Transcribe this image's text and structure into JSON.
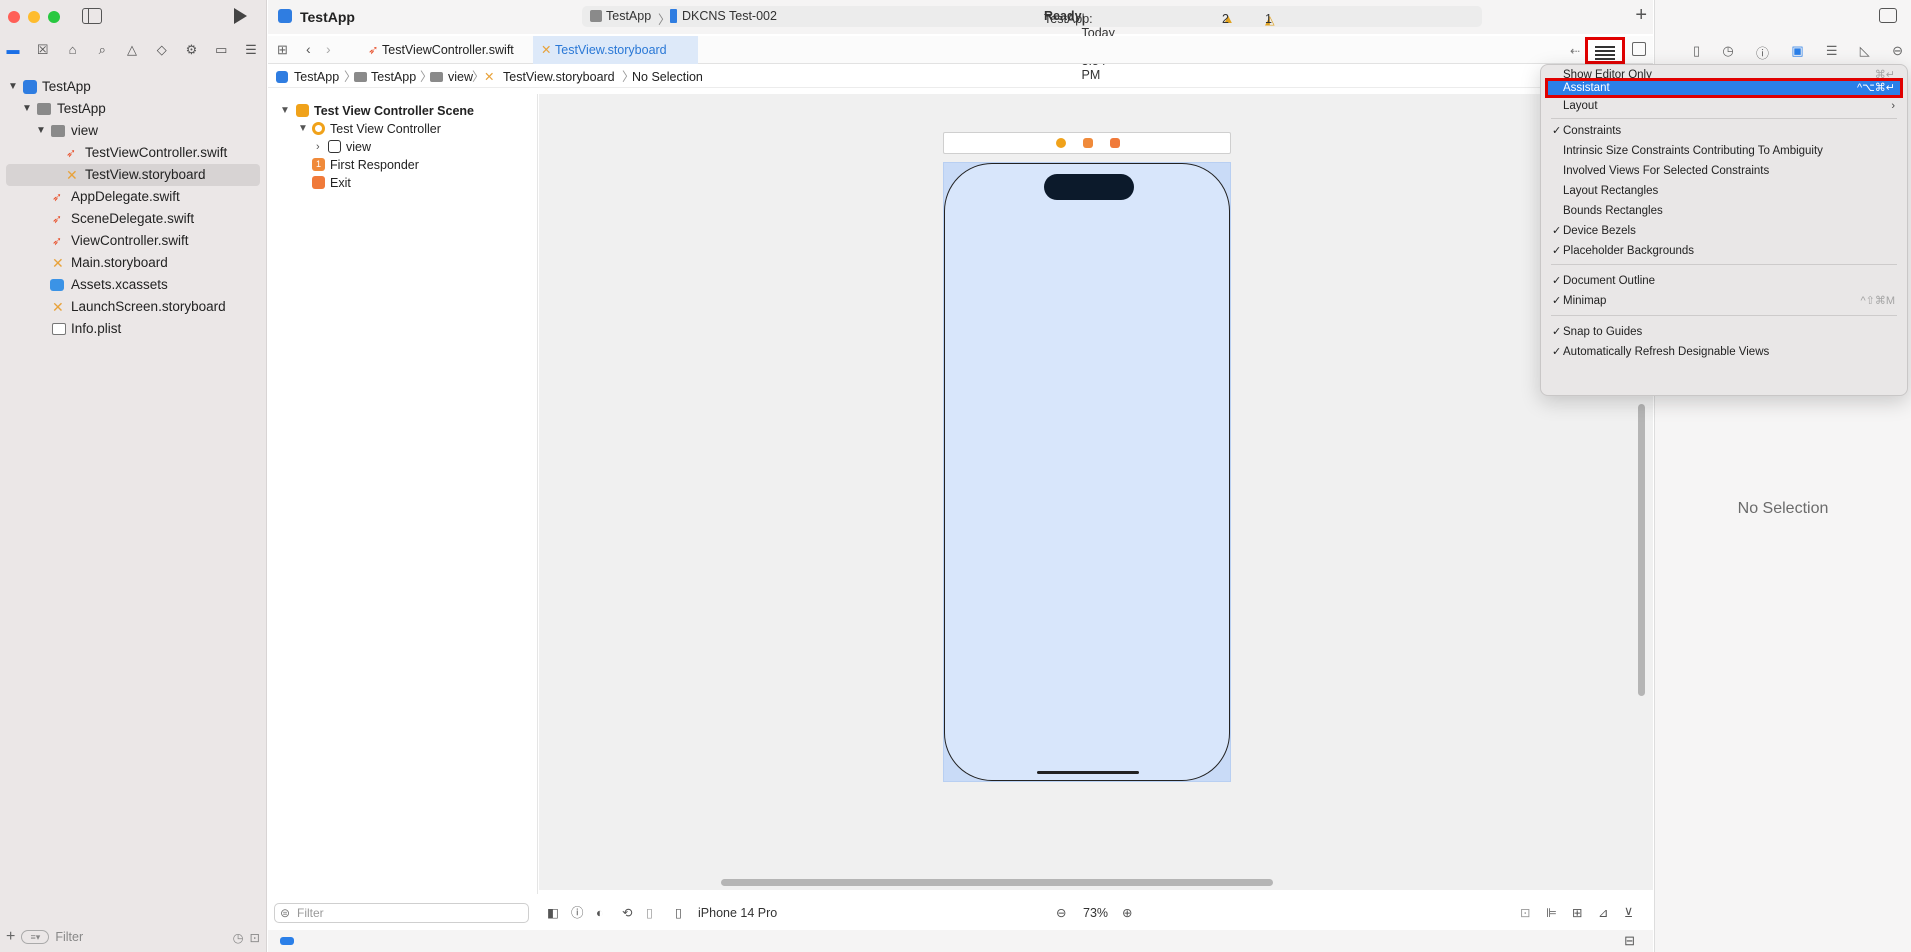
{
  "window": {
    "app_name": "TestApp"
  },
  "navigator": {
    "tree": [
      {
        "label": "TestApp",
        "icon": "project-icon",
        "expanded": true
      },
      {
        "label": "TestApp",
        "icon": "folder-icon",
        "expanded": true
      },
      {
        "label": "view",
        "icon": "folder-icon",
        "expanded": true
      },
      {
        "label": "TestViewController.swift",
        "icon": "swift-file-icon"
      },
      {
        "label": "TestView.storyboard",
        "icon": "storyboard-icon",
        "selected": true
      },
      {
        "label": "AppDelegate.swift",
        "icon": "swift-file-icon"
      },
      {
        "label": "SceneDelegate.swift",
        "icon": "swift-file-icon"
      },
      {
        "label": "ViewController.swift",
        "icon": "swift-file-icon"
      },
      {
        "label": "Main.storyboard",
        "icon": "storyboard-icon"
      },
      {
        "label": "Assets.xcassets",
        "icon": "assets-icon"
      },
      {
        "label": "LaunchScreen.storyboard",
        "icon": "storyboard-icon"
      },
      {
        "label": "Info.plist",
        "icon": "plist-icon"
      }
    ],
    "filter_placeholder": "Filter"
  },
  "toolbar": {
    "scheme": "TestApp",
    "destination": "DKCNS Test-002",
    "status_prefix": "TestApp: ",
    "status_bold": "Ready",
    "status_suffix": " | Today at 3:54 PM",
    "warnings": "2",
    "issues": "1"
  },
  "tabs": [
    {
      "label": "TestViewController.swift",
      "active": false
    },
    {
      "label": "TestView.storyboard",
      "active": true
    }
  ],
  "jumpbar": [
    "TestApp",
    "TestApp",
    "view",
    "TestView.storyboard",
    "No Selection"
  ],
  "outline": {
    "scene": "Test View Controller Scene",
    "controller": "Test View Controller",
    "view": "view",
    "first_responder": "First Responder",
    "exit": "Exit"
  },
  "canvas_bottom": {
    "filter_placeholder": "Filter",
    "device": "iPhone 14 Pro",
    "zoom": "73%"
  },
  "inspector": {
    "empty_text": "No Selection"
  },
  "menu": {
    "items": [
      {
        "label": "Show Editor Only",
        "shortcut": "⌘↵",
        "checked": false
      },
      {
        "label": "Assistant",
        "shortcut": "^⌥⌘↵",
        "checked": false,
        "highlighted": true
      },
      {
        "label": "Layout",
        "shortcut": "",
        "submenu": true
      },
      {
        "label": "Constraints",
        "checked": true
      },
      {
        "label": "Intrinsic Size Constraints Contributing To Ambiguity",
        "checked": false
      },
      {
        "label": "Involved Views For Selected Constraints",
        "checked": false
      },
      {
        "label": "Layout Rectangles",
        "checked": false
      },
      {
        "label": "Bounds Rectangles",
        "checked": false
      },
      {
        "label": "Device Bezels",
        "checked": true
      },
      {
        "label": "Placeholder Backgrounds",
        "checked": true
      },
      {
        "label": "Document Outline",
        "checked": true
      },
      {
        "label": "Minimap",
        "shortcut": "^⇧⌘M",
        "checked": true
      },
      {
        "label": "Snap to Guides",
        "checked": true
      },
      {
        "label": "Automatically Refresh Designable Views",
        "checked": true
      }
    ]
  },
  "colors": {
    "accent": "#2b7fe8",
    "highlight_border": "#e00000",
    "canvas": "#f0f0f0"
  }
}
